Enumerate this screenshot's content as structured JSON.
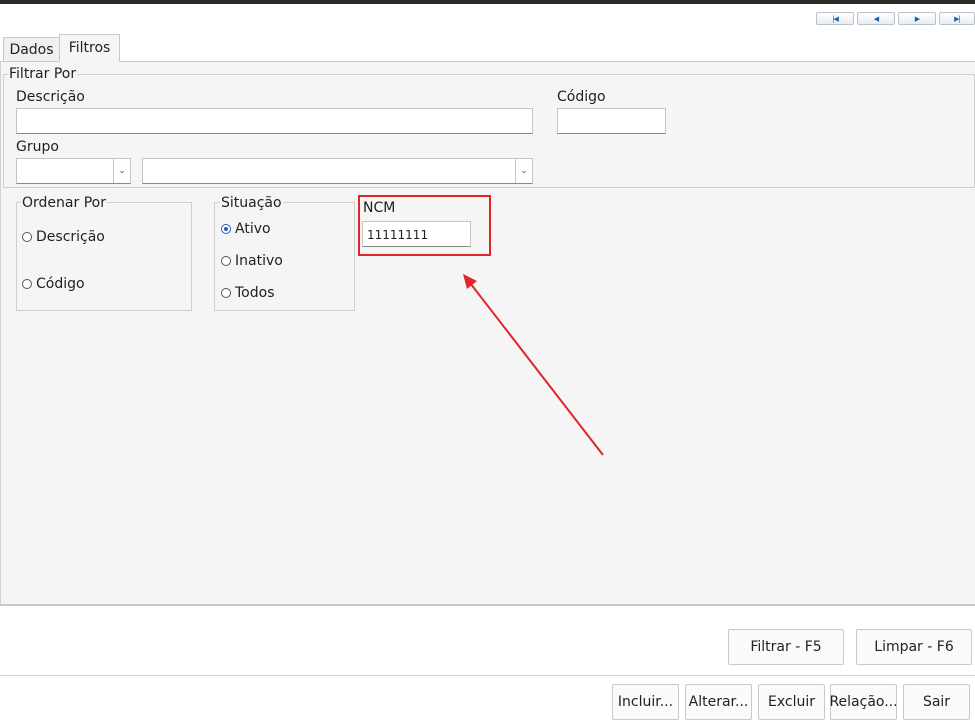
{
  "nav": {
    "first_icon": "first-page-icon",
    "prev_icon": "previous-icon",
    "next_icon": "next-icon",
    "last_icon": "last-page-icon"
  },
  "tabs": [
    {
      "label": "Dados",
      "active": false
    },
    {
      "label": "Filtros",
      "active": true
    }
  ],
  "filtrar": {
    "legend": "Filtrar Por",
    "descricao_label": "Descrição",
    "descricao_value": "",
    "codigo_label": "Código",
    "codigo_value": "",
    "grupo_label": "Grupo",
    "grupo_code_value": "",
    "grupo_name_value": ""
  },
  "ordenar": {
    "legend": "Ordenar Por",
    "options": [
      {
        "label": "Descrição",
        "checked": false
      },
      {
        "label": "Código",
        "checked": false
      }
    ]
  },
  "situacao": {
    "legend": "Situação",
    "options": [
      {
        "label": "Ativo",
        "checked": true
      },
      {
        "label": "Inativo",
        "checked": false
      },
      {
        "label": "Todos",
        "checked": false
      }
    ]
  },
  "ncm": {
    "label": "NCM",
    "value": "11111111",
    "highlight_color": "#e0252b"
  },
  "filter_buttons": {
    "filtrar": "Filtrar - F5",
    "limpar": "Limpar - F6"
  },
  "bottom_buttons": {
    "incluir": "Incluir...",
    "alterar": "Alterar...",
    "excluir": "Excluir",
    "relacao": "Relação...",
    "sair": "Sair"
  },
  "annotation": {
    "color": "#e0252b"
  }
}
